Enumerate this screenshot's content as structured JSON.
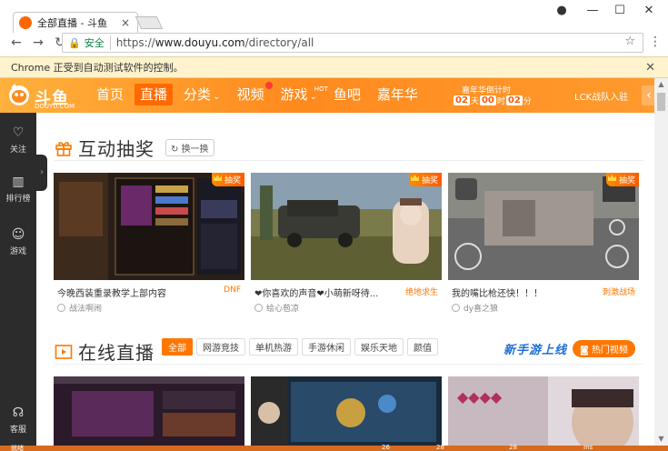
{
  "browser": {
    "tab_title": "全部直播 - 斗鱼",
    "secure_label": "安全",
    "url_scheme": "https://",
    "url_host": "www.douyu.com",
    "url_path": "/directory/all",
    "infobar_text": "Chrome 正受到自动测试软件的控制。"
  },
  "site": {
    "logo_text": "斗鱼",
    "logo_sub": "DOUYU.COM",
    "nav": [
      {
        "label": "首页"
      },
      {
        "label": "直播"
      },
      {
        "label": "分类"
      },
      {
        "label": "视频"
      },
      {
        "label": "游戏",
        "badge": "HOT"
      },
      {
        "label": "鱼吧"
      },
      {
        "label": "嘉年华"
      }
    ],
    "countdown": {
      "title": "嘉年华倒计时",
      "days": "02",
      "hours": "00",
      "minutes": "02",
      "day_unit": "天",
      "hour_unit": "时",
      "minute_unit": "分"
    },
    "lck_text": "LCK战队入驻"
  },
  "sidebar": {
    "items": [
      {
        "label": "关注"
      },
      {
        "label": "排行榜"
      },
      {
        "label": "游戏"
      },
      {
        "label": "客服"
      }
    ]
  },
  "lottery_section": {
    "title": "互动抽奖",
    "refresh_label": "换一换",
    "cards": [
      {
        "title": "今晚西装重录教学上部内容",
        "category": "DNF",
        "user": "战法啊闹",
        "badge": "抽奖"
      },
      {
        "title": "❤你喜欢的声音❤小萌新呀待...",
        "category": "绝地求生",
        "user": "绘心苞凉",
        "badge": "抽奖"
      },
      {
        "title": "我的嘴比枪还快！！！",
        "category": "刺激战场",
        "user": "dy喜之狼",
        "badge": "抽奖"
      }
    ]
  },
  "live_section": {
    "title": "在线直播",
    "filters": [
      "全部",
      "网游竞技",
      "单机热游",
      "手游休闲",
      "娱乐天地",
      "颜值"
    ],
    "promo_text": "新手游上线",
    "hot_video_label": "热门视频"
  },
  "taskbar": {
    "left_text": "就绪",
    "items": [
      "26",
      "28",
      "28"
    ],
    "ins": "Ins"
  },
  "colors": {
    "brand_orange": "#ff7700",
    "sidebar_bg": "#2c2c2c",
    "secure_green": "#0b8043"
  }
}
